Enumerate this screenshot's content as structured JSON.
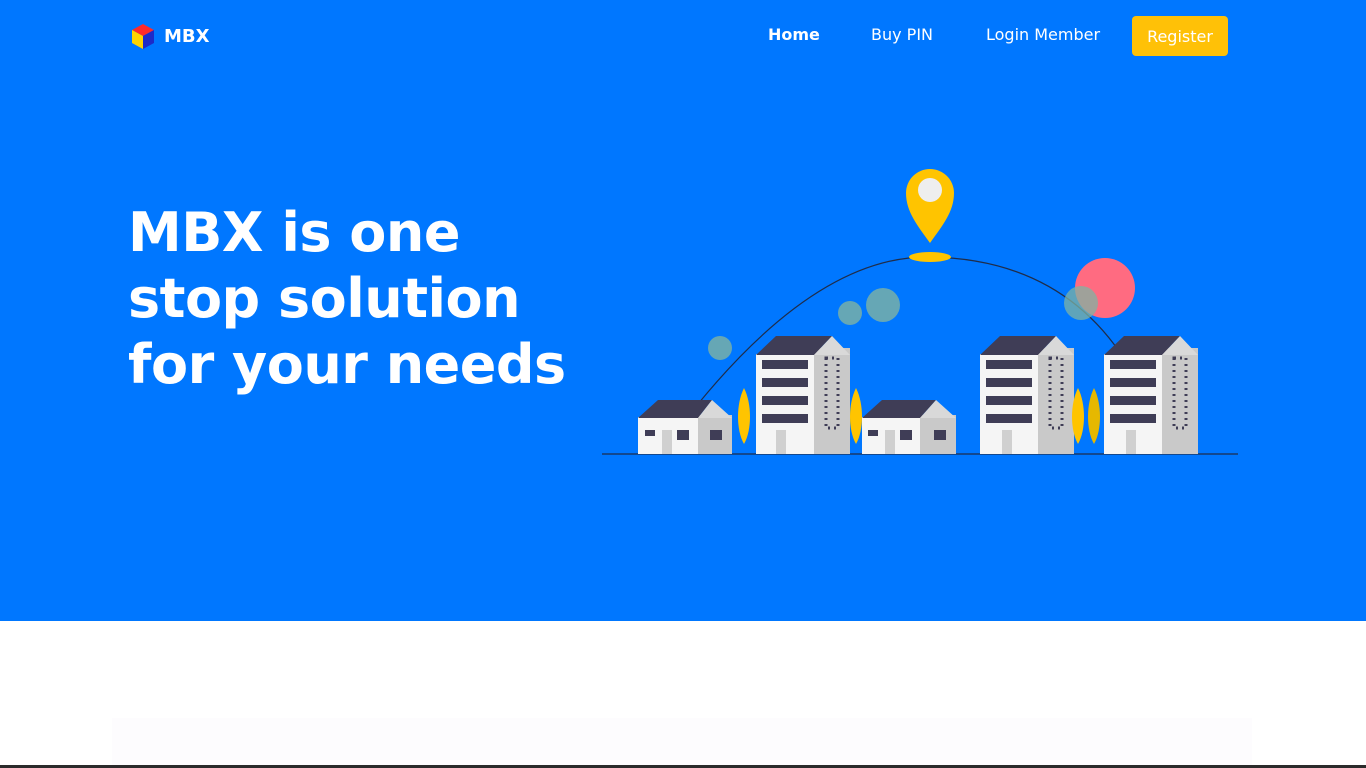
{
  "brand": {
    "name": "MBX",
    "logo_icon": "cube-logo-icon"
  },
  "nav": {
    "home": "Home",
    "buy_pin": "Buy PIN",
    "login": "Login Member",
    "register": "Register"
  },
  "hero": {
    "headline": "MBX is one stop solution for your needs",
    "illustration": "city-buildings-location-pin-illustration"
  },
  "colors": {
    "hero_bg": "#0077ff",
    "accent": "#ffc107",
    "text": "#ffffff"
  }
}
